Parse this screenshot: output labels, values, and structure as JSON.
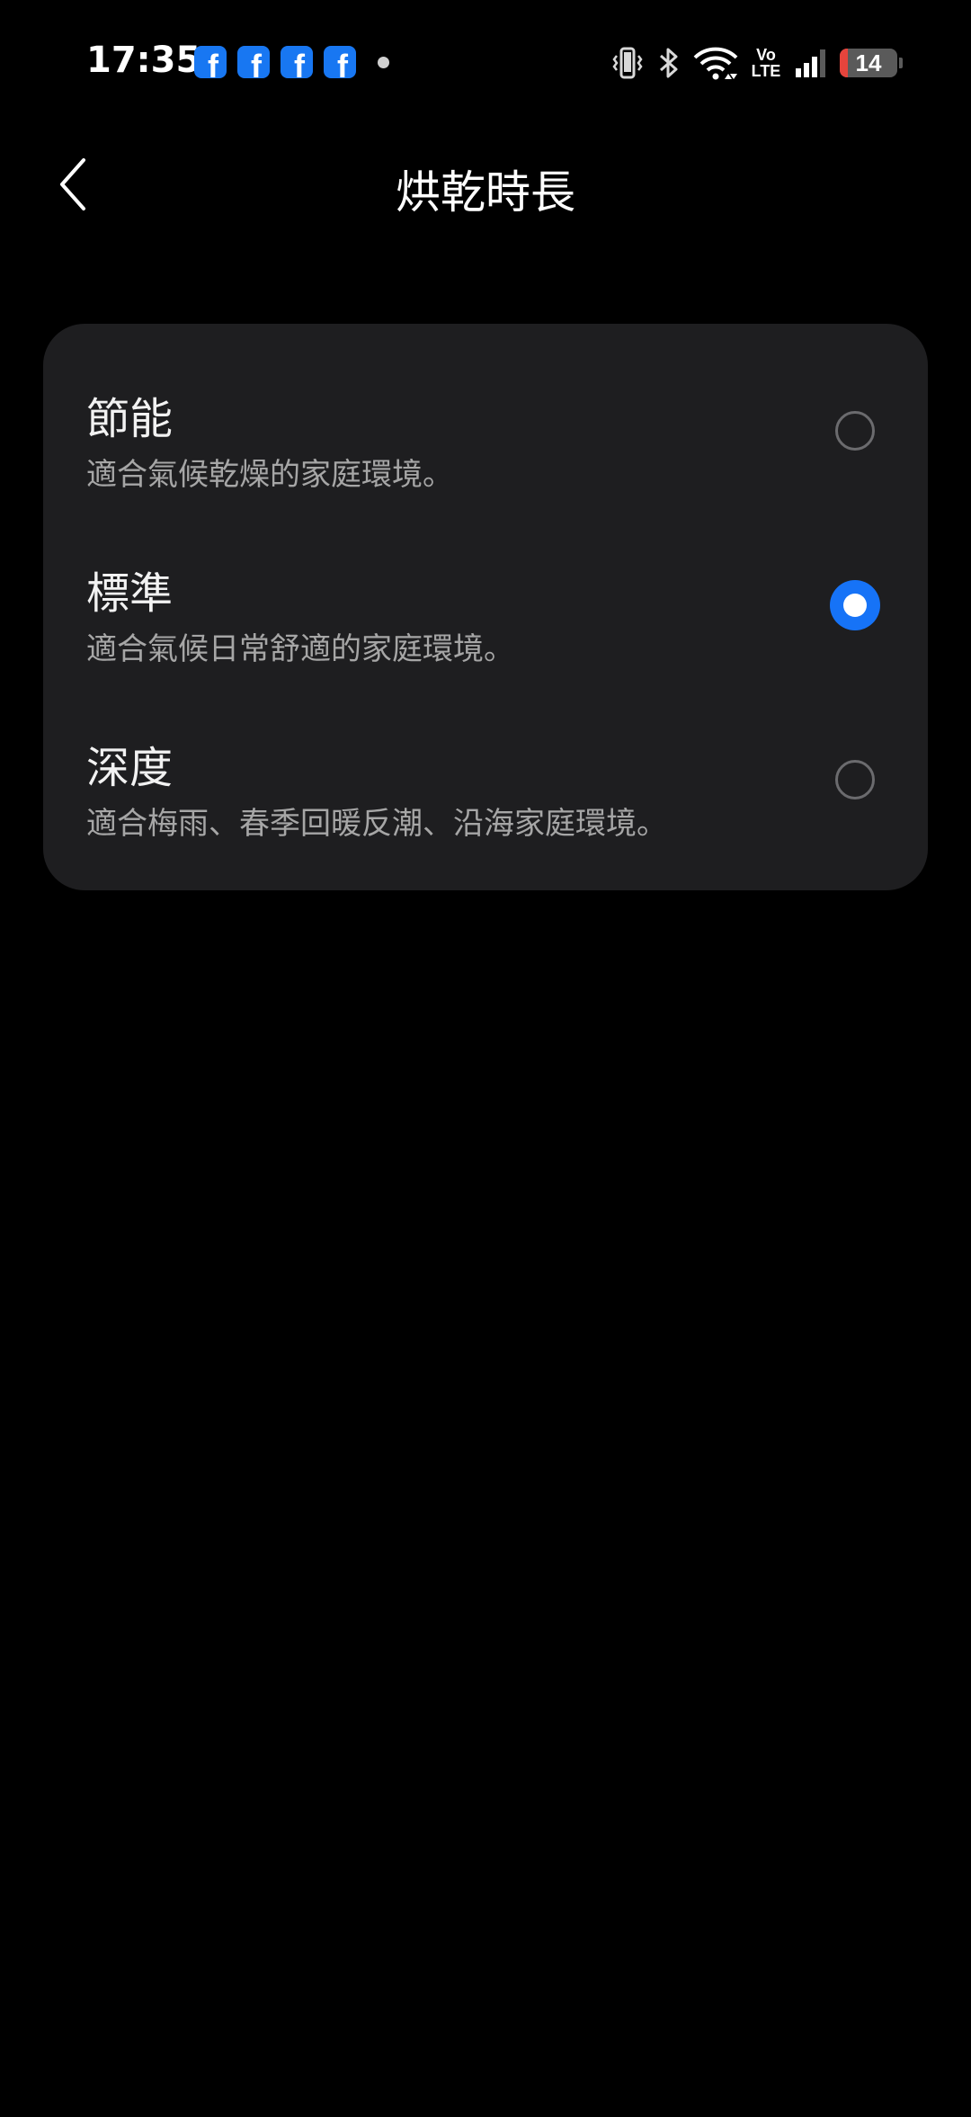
{
  "status_bar": {
    "time": "17:35",
    "notification_icons": [
      "facebook-icon",
      "facebook-icon",
      "facebook-icon",
      "facebook-icon"
    ],
    "volte_top": "Vo",
    "volte_bottom": "LTE",
    "battery_level": "14",
    "battery_color": "#e5443c"
  },
  "header": {
    "title": "烘乾時長"
  },
  "options": [
    {
      "title": "節能",
      "description": "適合氣候乾燥的家庭環境。",
      "selected": false
    },
    {
      "title": "標準",
      "description": "適合氣候日常舒適的家庭環境。",
      "selected": true
    },
    {
      "title": "深度",
      "description": "適合梅雨、春季回暖反潮、沿海家庭環境。",
      "selected": false
    }
  ],
  "colors": {
    "accent": "#1673f7",
    "card_background": "#1e1e20",
    "background": "#000000"
  }
}
